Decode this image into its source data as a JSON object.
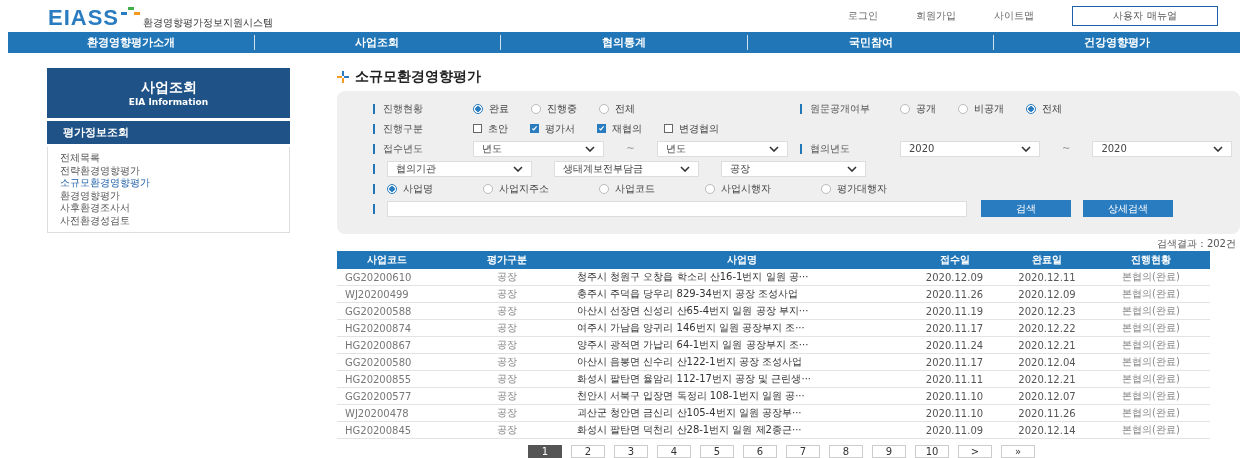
{
  "header": {
    "logo": "EIASS",
    "subtitle": "환경영향평가정보지원시스템",
    "links": [
      {
        "label": "로그인",
        "kind": "link"
      },
      {
        "label": "회원가입",
        "kind": "link"
      },
      {
        "label": "사이트맵",
        "kind": "link"
      },
      {
        "label": "사용자 매뉴얼",
        "kind": "button"
      }
    ]
  },
  "nav": [
    "환경영향평가소개",
    "사업조회",
    "협의통계",
    "국민참여",
    "건강영향평가"
  ],
  "sidebar": {
    "title": "사업조회",
    "subtitle": "EIA Information",
    "section": "평가정보조회",
    "items": [
      {
        "label": "전체목록",
        "selected": false
      },
      {
        "label": "전략환경영향평가",
        "selected": false
      },
      {
        "label": "소규모환경영향평가",
        "selected": true
      },
      {
        "label": "환경영향평가",
        "selected": false
      },
      {
        "label": "사후환경조사서",
        "selected": false
      },
      {
        "label": "사전환경성검토",
        "selected": false
      }
    ]
  },
  "page_title": "소규모환경영향평가",
  "search": {
    "status": {
      "label": "진행현황",
      "options": [
        {
          "label": "완료",
          "selected": true
        },
        {
          "label": "진행중",
          "selected": false
        },
        {
          "label": "전체",
          "selected": false
        }
      ]
    },
    "disclosure": {
      "label": "원문공개여부",
      "options": [
        {
          "label": "공개",
          "selected": false
        },
        {
          "label": "비공개",
          "selected": false
        },
        {
          "label": "전체",
          "selected": true
        }
      ]
    },
    "stage": {
      "label": "진행구분",
      "options": [
        {
          "label": "초안",
          "checked": false
        },
        {
          "label": "평가서",
          "checked": true
        },
        {
          "label": "재협의",
          "checked": true
        },
        {
          "label": "변경협의",
          "checked": false
        }
      ]
    },
    "receipt_year": {
      "label": "접수년도",
      "from": "년도",
      "to": "년도",
      "separator": "~"
    },
    "consult_year": {
      "label": "협의년도",
      "from": "2020",
      "to": "2020",
      "separator": "~"
    },
    "filters": [
      "협의기관",
      "생태계보전부담금",
      "공장"
    ],
    "field_options": [
      {
        "label": "사업명",
        "selected": true
      },
      {
        "label": "사업지주소",
        "selected": false
      },
      {
        "label": "사업코드",
        "selected": false
      },
      {
        "label": "사업시행자",
        "selected": false
      },
      {
        "label": "평가대행자",
        "selected": false
      }
    ],
    "buttons": [
      "검색",
      "상세검색"
    ]
  },
  "result_count": "검색결과 : 202건",
  "table": {
    "columns": [
      "사업코드",
      "평가구분",
      "사업명",
      "접수일",
      "완료일",
      "진행현황"
    ],
    "rows": [
      [
        "GG20200610",
        "공장",
        "청주시 청원구 오창읍 학소리 산16-1번지 일원 공···",
        "2020.12.09",
        "2020.12.11",
        "본협의(완료)"
      ],
      [
        "WJ20200499",
        "공장",
        "충주시 주덕읍 당우리 829-34번지 공장 조성사업",
        "2020.11.26",
        "2020.12.09",
        "본협의(완료)"
      ],
      [
        "GG20200588",
        "공장",
        "아산시 선장면 신성리 산65-4번지 일원 공장 부지···",
        "2020.11.19",
        "2020.12.23",
        "본협의(완료)"
      ],
      [
        "HG20200874",
        "공장",
        "여주시 가남읍 양귀리 146번지 일원 공장부지 조···",
        "2020.11.17",
        "2020.12.22",
        "본협의(완료)"
      ],
      [
        "HG20200867",
        "공장",
        "양주시 광적면 가납리 64-1번지 일원 공장부지 조···",
        "2020.11.24",
        "2020.12.21",
        "본협의(완료)"
      ],
      [
        "GG20200580",
        "공장",
        "아산시 음봉면 신수리 산122-1번지 공장 조성사업",
        "2020.11.17",
        "2020.12.04",
        "본협의(완료)"
      ],
      [
        "HG20200855",
        "공장",
        "화성시 팔탄면 율암리 112-17번지 공장 및 근린생···",
        "2020.11.11",
        "2020.12.21",
        "본협의(완료)"
      ],
      [
        "GG20200577",
        "공장",
        "천안시 서북구 입장면 독정리 108-1번지 일원 공···",
        "2020.11.10",
        "2020.12.07",
        "본협의(완료)"
      ],
      [
        "WJ20200478",
        "공장",
        "괴산군 청안면 금신리 산105-4번지 일원 공장부···",
        "2020.11.10",
        "2020.11.26",
        "본협의(완료)"
      ],
      [
        "HG20200845",
        "공장",
        "화성시 팔탄면 덕천리 산28-1번지 일원 제2종근···",
        "2020.11.09",
        "2020.12.14",
        "본협의(완료)"
      ]
    ]
  },
  "pagination": [
    {
      "label": "1",
      "selected": true
    },
    {
      "label": "2",
      "selected": false
    },
    {
      "label": "3",
      "selected": false
    },
    {
      "label": "4",
      "selected": false
    },
    {
      "label": "5",
      "selected": false
    },
    {
      "label": "6",
      "selected": false
    },
    {
      "label": "7",
      "selected": false
    },
    {
      "label": "8",
      "selected": false
    },
    {
      "label": "9",
      "selected": false
    },
    {
      "label": "10",
      "selected": false
    },
    {
      "label": ">",
      "selected": false
    },
    {
      "label": "»",
      "selected": false
    }
  ]
}
